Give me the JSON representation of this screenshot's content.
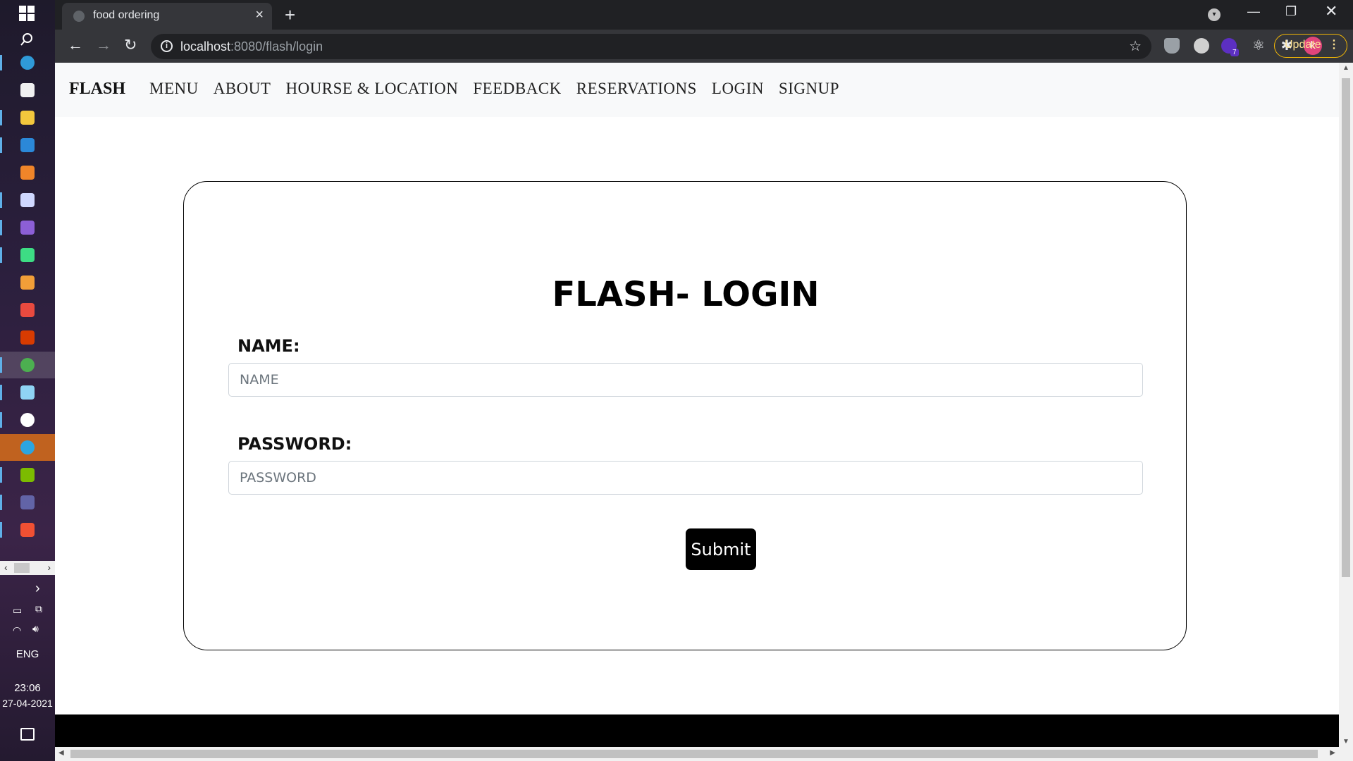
{
  "taskbar": {
    "apps": [
      {
        "name": "edge-app",
        "color": "#2f9ad8"
      },
      {
        "name": "store-app",
        "color": "#f0f0f0"
      },
      {
        "name": "file-explorer-app",
        "color": "#f3c73d"
      },
      {
        "name": "mail-app",
        "color": "#2b88d8"
      },
      {
        "name": "xampp-app",
        "color": "#f08529"
      },
      {
        "name": "media-app",
        "color": "#d0d8ff"
      },
      {
        "name": "visual-studio-app",
        "color": "#8c5fd6"
      },
      {
        "name": "android-studio-app",
        "color": "#3ddc84"
      },
      {
        "name": "sublime-app",
        "color": "#f29e38"
      },
      {
        "name": "record-app",
        "color": "#e84a3f"
      },
      {
        "name": "office-app",
        "color": "#d83b01"
      },
      {
        "name": "chrome-app",
        "color": "#4caf50"
      },
      {
        "name": "notes-app",
        "color": "#8fd3f4"
      },
      {
        "name": "settings-app",
        "color": "#ffffff"
      },
      {
        "name": "telegram-app",
        "color": "#2ca5e0"
      },
      {
        "name": "apps-grid-app",
        "color": "#7cbb00"
      },
      {
        "name": "teams-app",
        "color": "#6264a7"
      },
      {
        "name": "git-app",
        "color": "#f05033"
      }
    ],
    "language": "ENG",
    "time": "23:06",
    "date": "27-04-2021"
  },
  "browser": {
    "tab_title": "food ordering",
    "url_host": "localhost",
    "url_path": ":8080/flash/login",
    "extension_badge": "7",
    "avatar_letter": "k",
    "update_label": "Update"
  },
  "site": {
    "brand": "FLASH",
    "nav": [
      "MENU",
      "ABOUT",
      "HOURSE & LOCATION",
      "FEEDBACK",
      "RESERVATIONS",
      "LOGIN",
      "SIGNUP"
    ]
  },
  "login": {
    "title": "FLASH- LOGIN",
    "name_label": "NAME:",
    "name_placeholder": "NAME",
    "password_label": "PASSWORD:",
    "password_placeholder": "PASSWORD",
    "submit_label": "Submit"
  }
}
